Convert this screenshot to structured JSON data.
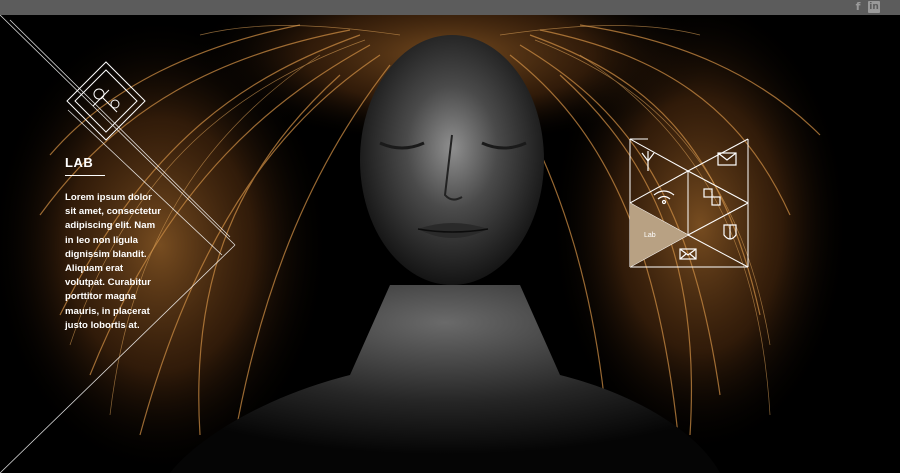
{
  "topbar": {
    "social": [
      {
        "name": "facebook-icon",
        "glyph": "f"
      },
      {
        "name": "linkedin-icon",
        "glyph": "in"
      }
    ]
  },
  "lab": {
    "title": "LAB",
    "body": "Lorem ipsum dolor sit amet, consectetur adipiscing elit. Nam in leo non ligula dignissim blandit. Aliquam erat volutpat. Curabitur porttitor magna mauris, in placerat justo lobortis at."
  },
  "menu": {
    "active_label": "Lab",
    "items": [
      {
        "name": "tree-icon"
      },
      {
        "name": "mail-icon"
      },
      {
        "name": "wifi-icon"
      },
      {
        "name": "blocks-icon"
      },
      {
        "name": "lab-item"
      },
      {
        "name": "shield-icon"
      },
      {
        "name": "envelope-icon"
      }
    ],
    "active_color": "#b8a183"
  },
  "colors": {
    "topbar": "#5c5c5c",
    "hair": "#c9863a",
    "text": "#ffffff"
  }
}
